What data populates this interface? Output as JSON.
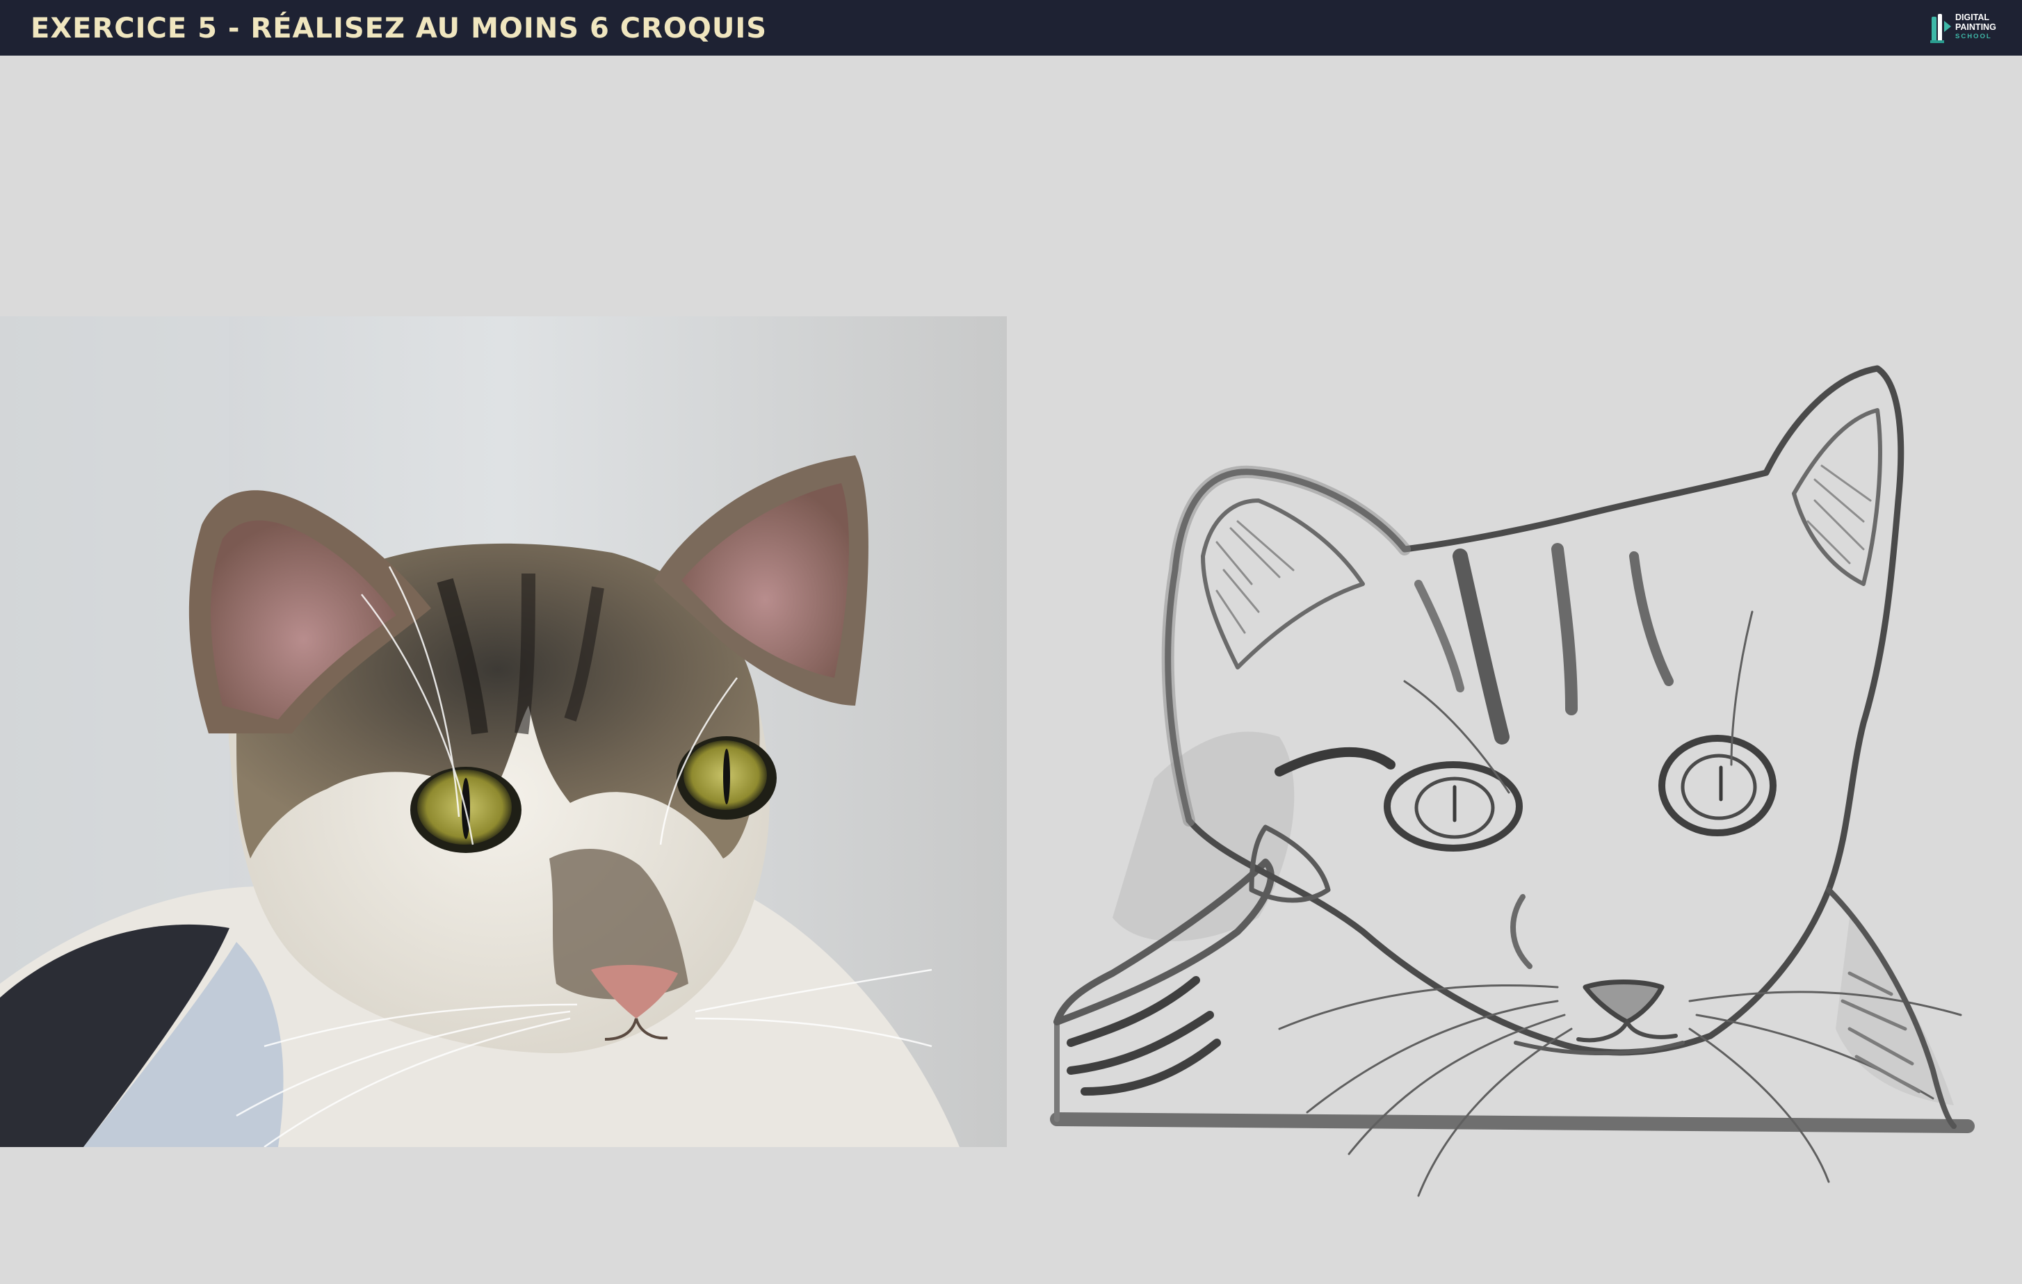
{
  "header": {
    "title": "EXERCICE 5 - RÉALISEZ AU MOINS 6 CROQUIS",
    "logo": {
      "line1": "DIGITAL",
      "line2": "PAINTING",
      "line3": "SCHOOL"
    }
  },
  "colors": {
    "header_bg": "#1e2233",
    "title_text": "#f0e6bf",
    "logo_accent": "#3fb8a8",
    "canvas_bg": "#dadada"
  },
  "content": {
    "reference_photo": "cat-reference-photo",
    "sketch": "cat-pencil-sketch"
  }
}
